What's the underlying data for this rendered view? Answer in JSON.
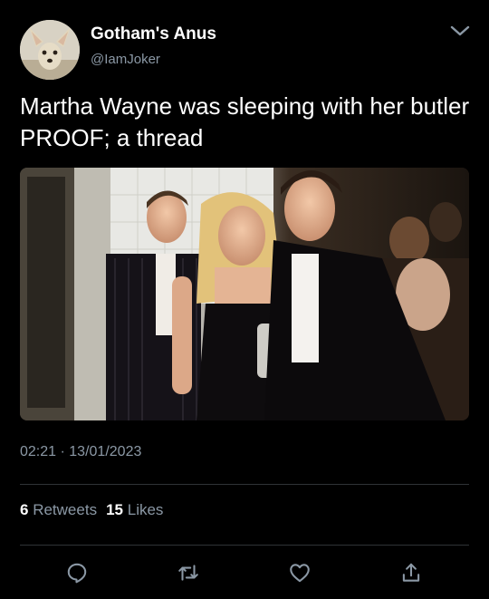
{
  "author": {
    "display_name": "Gotham's Anus",
    "handle": "@IamJoker",
    "avatar_icon": "chihuahua-avatar"
  },
  "tweet": {
    "text": "Martha Wayne was sleeping with her butler PROOF; a thread",
    "media_description_icon": "photo",
    "time": "02:21",
    "separator": "·",
    "date": "13/01/2023"
  },
  "stats": {
    "retweets_count": "6",
    "retweets_label": "Retweets",
    "likes_count": "15",
    "likes_label": "Likes"
  },
  "actions": {
    "reply_icon": "reply-icon",
    "retweet_icon": "retweet-icon",
    "like_icon": "heart-icon",
    "share_icon": "share-icon"
  },
  "colors": {
    "background": "#000000",
    "primary_text": "#ffffff",
    "secondary_text": "#8b98a5",
    "divider": "#2f3336"
  }
}
